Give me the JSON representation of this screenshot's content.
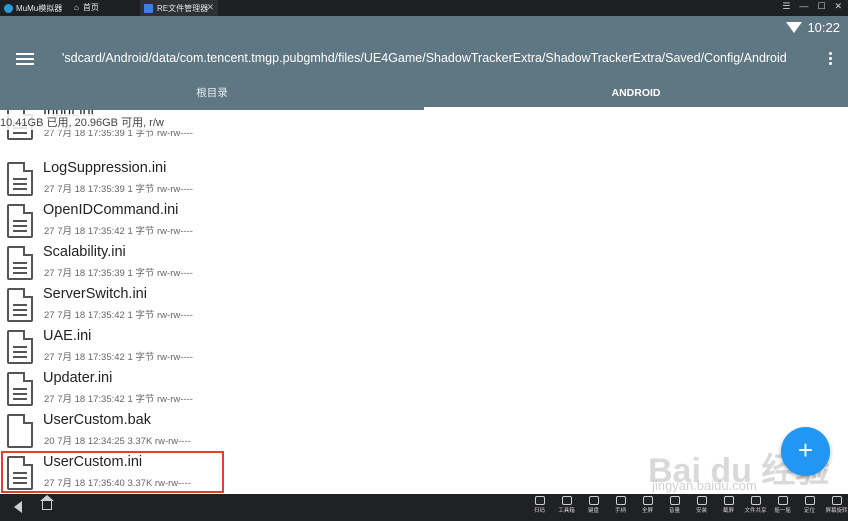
{
  "emulator": {
    "brand": "MuMu模拟器",
    "home_tab": "首页",
    "app_tab": "RE文件管理器",
    "controls": [
      "☰",
      "—",
      "☐",
      "✕"
    ]
  },
  "status_bar": {
    "time": "10:22"
  },
  "appbar": {
    "path": "'sdcard/Android/data/com.tencent.tmgp.pubgmhd/files/UE4Game/ShadowTrackerExtra/ShadowTrackerExtra/Saved/Config/Android"
  },
  "tabs": [
    {
      "label": "根目录",
      "active": false
    },
    {
      "label": "ANDROID",
      "active": true
    }
  ],
  "storage_info": "10.41GB 已用, 20.96GB 可用, r/w",
  "files": [
    {
      "name": "Input.ini",
      "meta": "27 7月 18 17:35:39  1 字节  rw-rw----"
    },
    {
      "name": "LogSuppression.ini",
      "meta": "27 7月 18 17:35:39  1 字节  rw-rw----"
    },
    {
      "name": "OpenIDCommand.ini",
      "meta": "27 7月 18 17:35:42  1 字节  rw-rw----"
    },
    {
      "name": "Scalability.ini",
      "meta": "27 7月 18 17:35:39  1 字节  rw-rw----"
    },
    {
      "name": "ServerSwitch.ini",
      "meta": "27 7月 18 17:35:42  1 字节  rw-rw----"
    },
    {
      "name": "UAE.ini",
      "meta": "27 7月 18 17:35:42  1 字节  rw-rw----"
    },
    {
      "name": "Updater.ini",
      "meta": "27 7月 18 17:35:42  1 字节  rw-rw----"
    },
    {
      "name": "UserCustom.bak",
      "meta": "20 7月 18 12:34:25  3.37K  rw-rw----"
    },
    {
      "name": "UserCustom.ini",
      "meta": "27 7月 18 17:35:40  3.37K  rw-rw----"
    }
  ],
  "fab_label": "+",
  "toolbar": [
    "扫码",
    "工具箱",
    "键盘",
    "手柄",
    "全屏",
    "音量",
    "安装",
    "截屏",
    "文件共享",
    "摇一摇",
    "定位",
    "屏幕旋转"
  ],
  "watermark": {
    "main": "Bai du 经验",
    "sub": "jingyan.baidu.com"
  },
  "colors": {
    "appbar": "#5f7683",
    "fab": "#2196f3",
    "highlight": "#e2402a"
  }
}
